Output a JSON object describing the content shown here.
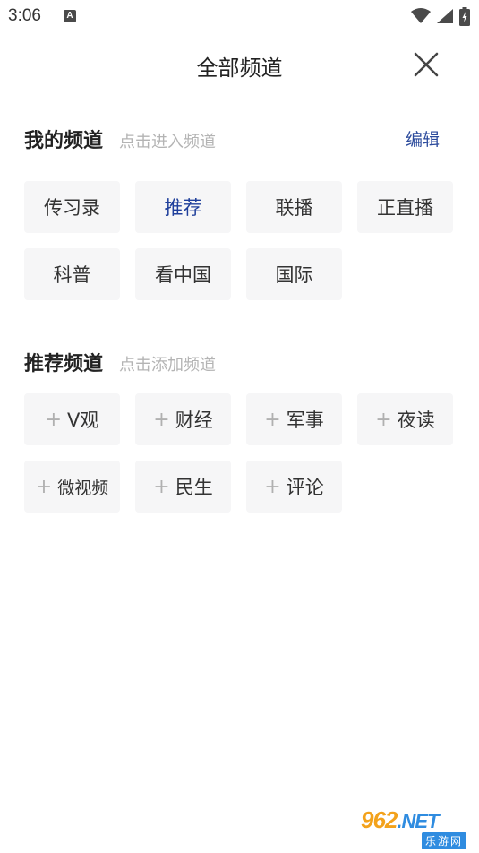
{
  "status_bar": {
    "time": "3:06",
    "notification_badge": "A",
    "icons": [
      "wifi-icon",
      "signal-icon",
      "battery-charging-icon"
    ]
  },
  "header": {
    "title": "全部频道",
    "close_icon": "close-icon"
  },
  "my_channels": {
    "title": "我的频道",
    "hint": "点击进入频道",
    "edit_label": "编辑",
    "accent_color": "#1f3f9b",
    "items": [
      {
        "label": "传习录",
        "active": false
      },
      {
        "label": "推荐",
        "active": true
      },
      {
        "label": "联播",
        "active": false
      },
      {
        "label": "正直播",
        "active": false
      },
      {
        "label": "科普",
        "active": false
      },
      {
        "label": "看中国",
        "active": false
      },
      {
        "label": "国际",
        "active": false
      }
    ]
  },
  "recommended_channels": {
    "title": "推荐频道",
    "hint": "点击添加频道",
    "plus_symbol": "+",
    "items": [
      {
        "label": "V观"
      },
      {
        "label": "财经"
      },
      {
        "label": "军事"
      },
      {
        "label": "夜读"
      },
      {
        "label": "微视频"
      },
      {
        "label": "民生"
      },
      {
        "label": "评论"
      }
    ]
  },
  "watermark": {
    "logo_number": "962",
    "logo_suffix": ".NET",
    "site_name": "乐游网"
  }
}
